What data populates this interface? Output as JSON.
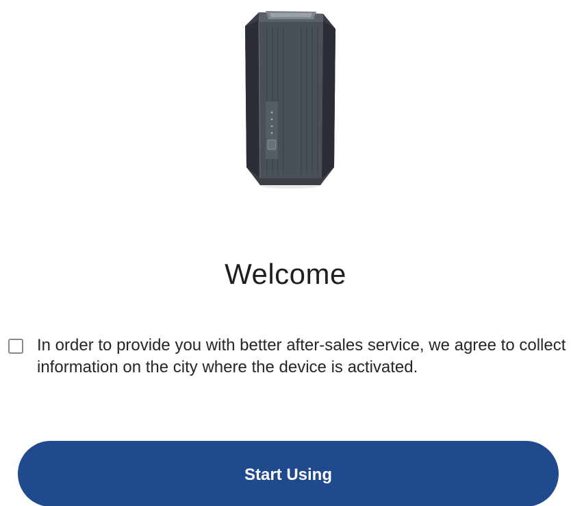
{
  "device": {
    "image": "router-device-illustration"
  },
  "welcome": {
    "title": "Welcome"
  },
  "consent": {
    "checked": false,
    "text": "In order to provide you with better after-sales service, we agree to collect information on the city where the device is activated."
  },
  "actions": {
    "start_label": "Start Using"
  },
  "colors": {
    "primary_button": "#1f4a8d",
    "device_body": "#4a5058",
    "device_dark": "#2b2f35"
  }
}
